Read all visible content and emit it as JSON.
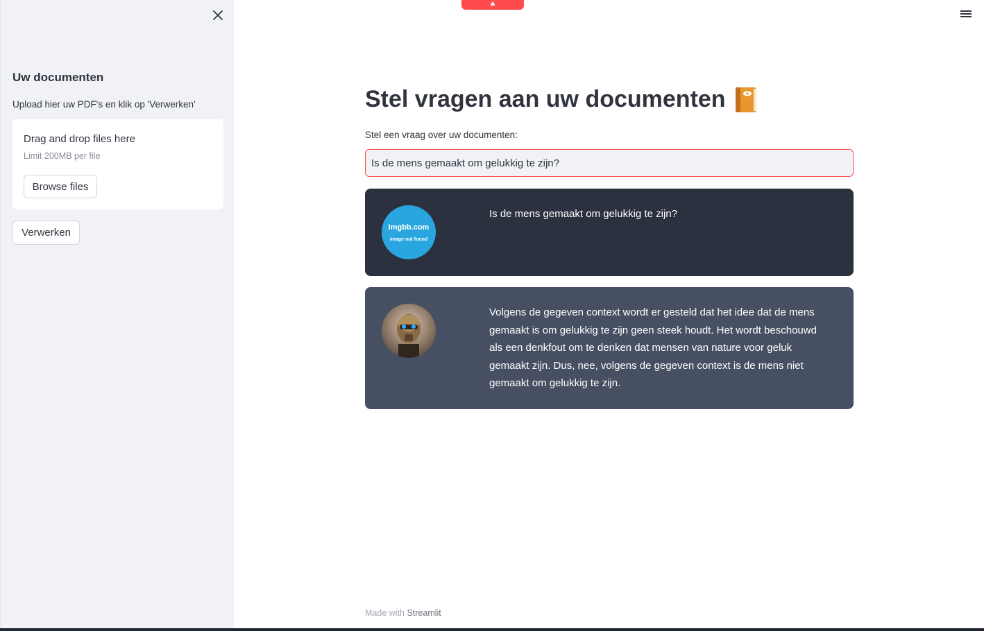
{
  "sidebar": {
    "title": "Uw documenten",
    "caption": "Upload hier uw PDF's en klik op 'Verwerken'",
    "uploader": {
      "drop_label": "Drag and drop files here",
      "limit_label": "Limit 200MB per file",
      "browse_label": "Browse files"
    },
    "process_label": "Verwerken"
  },
  "main": {
    "title": "Stel vragen aan uw documenten",
    "title_icon": "notebook-icon",
    "input_label": "Stel een vraag over uw documenten:",
    "input_value": "Is de mens gemaakt om gelukkig te zijn?",
    "messages": [
      {
        "role": "user",
        "avatar_text_1": "imgbb.com",
        "avatar_text_2": "image not found",
        "text": "Is de mens gemaakt om gelukkig te zijn?"
      },
      {
        "role": "bot",
        "avatar": "robot-avatar",
        "text": "Volgens de gegeven context wordt er gesteld dat het idee dat de mens gemaakt is om gelukkig te zijn geen steek houdt. Het wordt beschouwd als een denkfout om te denken dat mensen van nature voor geluk gemaakt zijn. Dus, nee, volgens de gegeven context is de mens niet gemaakt om gelukkig te zijn."
      }
    ],
    "footer_prefix": "Made with ",
    "footer_link": "Streamlit"
  },
  "colors": {
    "accent": "#ff4b4b",
    "sidebar_bg": "#f0f2f6",
    "user_bubble": "#2b313e",
    "bot_bubble": "#475063"
  }
}
